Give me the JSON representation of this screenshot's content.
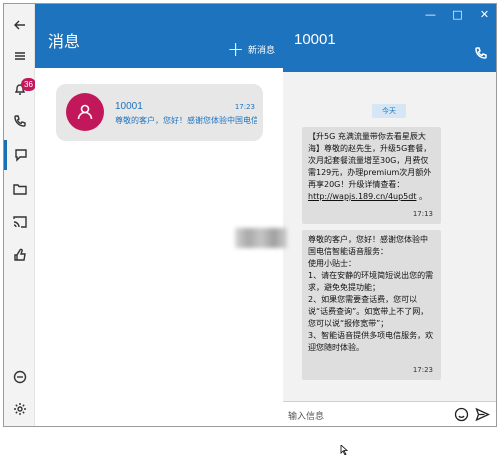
{
  "sidebar": {
    "badge_count": "36"
  },
  "list": {
    "title": "消息",
    "new_message_label": "新消息",
    "conversations": [
      {
        "name": "10001",
        "time": "17:23",
        "preview": "尊敬的客户，您好！感谢您体验中国电信"
      }
    ]
  },
  "chat": {
    "title": "10001",
    "date_divider": "今天",
    "messages": [
      {
        "text": "【升5G 充满流量带你去看星辰大海】尊敬的赵先生，升级5G套餐，次月起套餐流量增至30G，月费仅需129元，办理premium次月额外再享20G！升级详情查看：",
        "link": "http://wapjs.189.cn/4up5dt",
        "time": "17:13"
      },
      {
        "text": "尊敬的客户，您好！感谢您体验中国电信智能语音服务：\n使用小贴士：\n1、请在安静的环境简短说出您的需求，避免免提功能；\n2、如果您需要查话费，您可以说“话费查询”。如宽带上不了网，您可以说“报修宽带”；\n3、智能语音提供多项电信服务，欢迎您随时体验。",
        "link": "",
        "time": "17:23"
      }
    ],
    "input_placeholder": "输入信息"
  },
  "colors": {
    "accent": "#1e73bf",
    "avatar": "#c2185b",
    "bubble": "#dedede"
  }
}
